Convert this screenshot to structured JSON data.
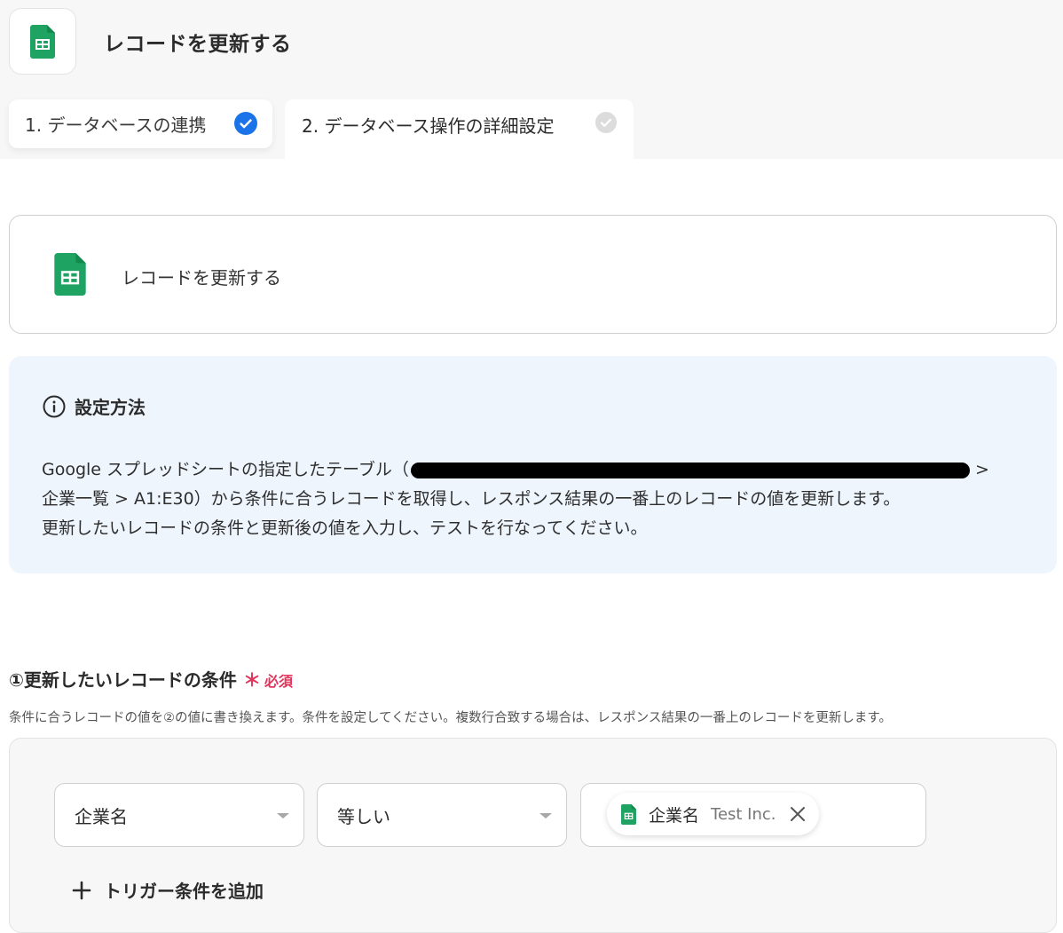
{
  "header": {
    "title": "レコードを更新する",
    "app_icon": "google-sheets-icon"
  },
  "steps": [
    {
      "label": "1. データベースの連携",
      "status": "completed"
    },
    {
      "label": "2. データベース操作の詳細設定",
      "status": "active"
    }
  ],
  "action_card": {
    "label": "レコードを更新する",
    "icon": "google-sheets-icon"
  },
  "info": {
    "title": "設定方法",
    "line1_before": "Google スプレッドシートの指定したテーブル（",
    "line1_after": " >",
    "line2": "企業一覧 > A1:E30）から条件に合うレコードを取得し、レスポンス結果の一番上のレコードの値を更新します。",
    "line3": "更新したいレコードの条件と更新後の値を入力し、テストを行なってください。"
  },
  "condition_section": {
    "title": "①更新したいレコードの条件",
    "required_star": "＊",
    "required_label": "必須",
    "description": "条件に合うレコードの値を②の値に書き換えます。条件を設定してください。複数行合致する場合は、レスポンス結果の一番上のレコードを更新します。",
    "field_select": "企業名",
    "operator_select": "等しい",
    "value_chip": {
      "name": "企業名",
      "value": "Test Inc."
    },
    "add_button": "トリガー条件を追加"
  },
  "colors": {
    "sheets_green": "#1ea362",
    "check_blue": "#1a73e8",
    "required_red": "#e0355c",
    "info_bg": "#eef5fd"
  }
}
